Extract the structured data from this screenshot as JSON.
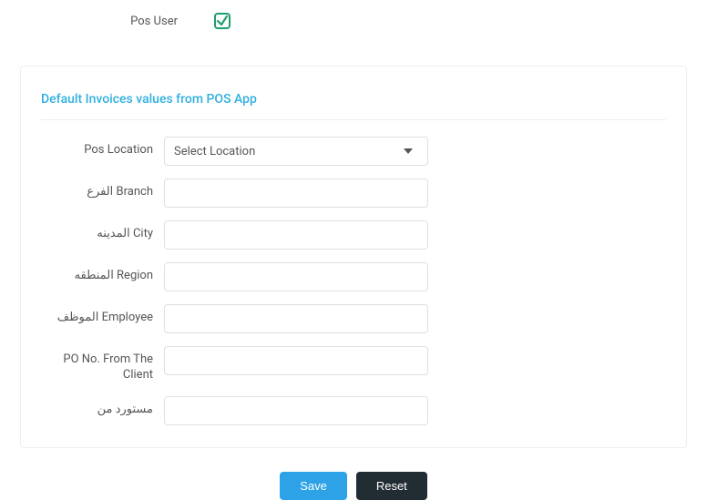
{
  "top": {
    "pos_user_label": "Pos User",
    "pos_user_checked": true
  },
  "card": {
    "title": "Default Invoices values from POS App"
  },
  "fields": {
    "pos_location": {
      "label": "Pos Location",
      "placeholder": "Select Location",
      "value": ""
    },
    "branch": {
      "label": "الفرع Branch",
      "value": ""
    },
    "city": {
      "label": "المدينه City",
      "value": ""
    },
    "region": {
      "label": "المنطقه Region",
      "value": ""
    },
    "employee": {
      "label": "الموظف Employee",
      "value": ""
    },
    "po_no": {
      "label": "PO No. From The Client",
      "value": ""
    },
    "imported_from": {
      "label": "مستورد من",
      "value": ""
    }
  },
  "buttons": {
    "save": "Save",
    "reset": "Reset"
  },
  "colors": {
    "accent": "#31b0e0",
    "check": "#1e9e6a"
  }
}
